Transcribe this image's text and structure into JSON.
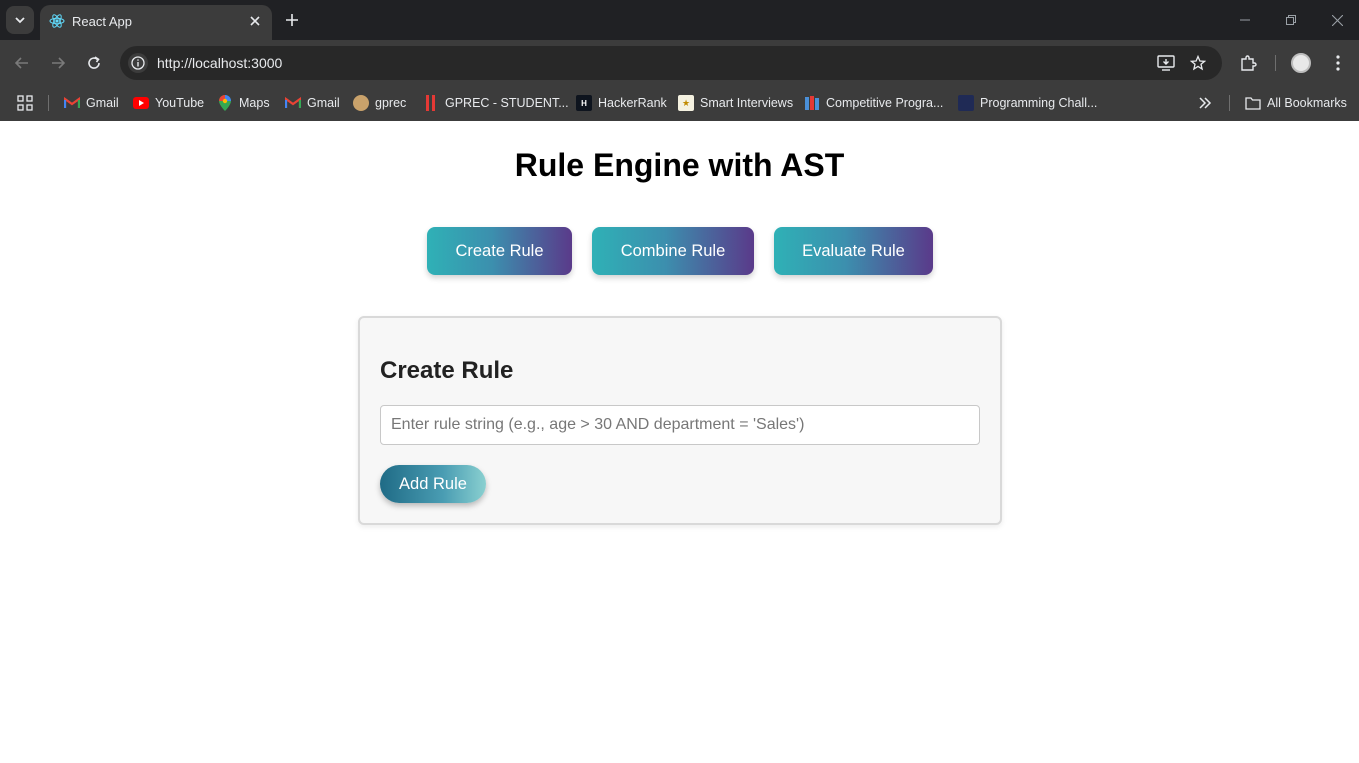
{
  "browser": {
    "tab_title": "React App",
    "url": "http://localhost:3000",
    "bookmarks": [
      {
        "label": "Gmail",
        "icon": "gmail-icon"
      },
      {
        "label": "YouTube",
        "icon": "youtube-icon"
      },
      {
        "label": "Maps",
        "icon": "maps-icon"
      },
      {
        "label": "Gmail",
        "icon": "gmail-icon"
      },
      {
        "label": "gprec",
        "icon": "gprec-icon"
      },
      {
        "label": "GPREC - STUDENT...",
        "icon": "gprec-student-icon"
      },
      {
        "label": "HackerRank",
        "icon": "hackerrank-icon"
      },
      {
        "label": "Smart Interviews",
        "icon": "smart-interviews-icon"
      },
      {
        "label": "Competitive Progra...",
        "icon": "competitive-programming-icon"
      },
      {
        "label": "Programming Chall...",
        "icon": "programming-challenges-icon"
      }
    ],
    "all_bookmarks": "All Bookmarks"
  },
  "page": {
    "title": "Rule Engine with AST",
    "tabs": [
      {
        "label": "Create Rule"
      },
      {
        "label": "Combine Rule"
      },
      {
        "label": "Evaluate Rule"
      }
    ],
    "card": {
      "title": "Create Rule",
      "input_placeholder": "Enter rule string (e.g., age > 30 AND department = 'Sales')",
      "input_value": "",
      "add_button": "Add Rule"
    }
  },
  "colors": {
    "gradient_start": "#2fb1b6",
    "gradient_end": "#5a3a8a",
    "chrome_dark": "#202124",
    "chrome_toolbar": "#3c3c3c"
  }
}
